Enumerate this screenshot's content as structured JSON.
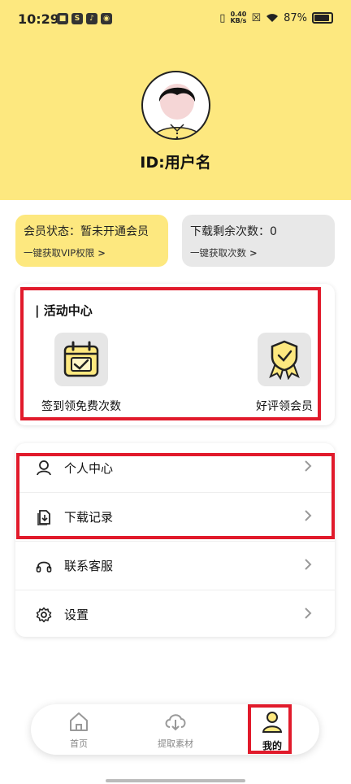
{
  "status_bar": {
    "time": "10:29",
    "net_speed_value": "0.40",
    "net_speed_unit": "KB/s",
    "battery": "87%"
  },
  "profile": {
    "user_id": "ID:用户名"
  },
  "vip_card": {
    "status": "会员状态：暂未开通会员",
    "link": "一键获取VIP权限"
  },
  "download_card": {
    "remaining": "下载剩余次数：0",
    "link": "一键获取次数"
  },
  "activity_center": {
    "title": "| 活动中心",
    "items": [
      {
        "label": "签到领免费次数",
        "icon": "calendar-check-icon"
      },
      {
        "label": "好评领会员",
        "icon": "badge-check-icon"
      }
    ]
  },
  "menu": {
    "items": [
      {
        "label": "个人中心",
        "icon": "user-icon"
      },
      {
        "label": "下载记录",
        "icon": "download-record-icon"
      },
      {
        "label": "联系客服",
        "icon": "headset-icon"
      },
      {
        "label": "设置",
        "icon": "gear-icon"
      }
    ]
  },
  "tabs": [
    {
      "label": "首页",
      "icon": "home-icon"
    },
    {
      "label": "提取素材",
      "icon": "cloud-download-icon"
    },
    {
      "label": "我的",
      "icon": "person-icon",
      "active": true
    }
  ],
  "colors": {
    "brand_yellow": "#fde87f",
    "highlight_red": "#e11a2b",
    "card_gray": "#e8e8e8"
  }
}
